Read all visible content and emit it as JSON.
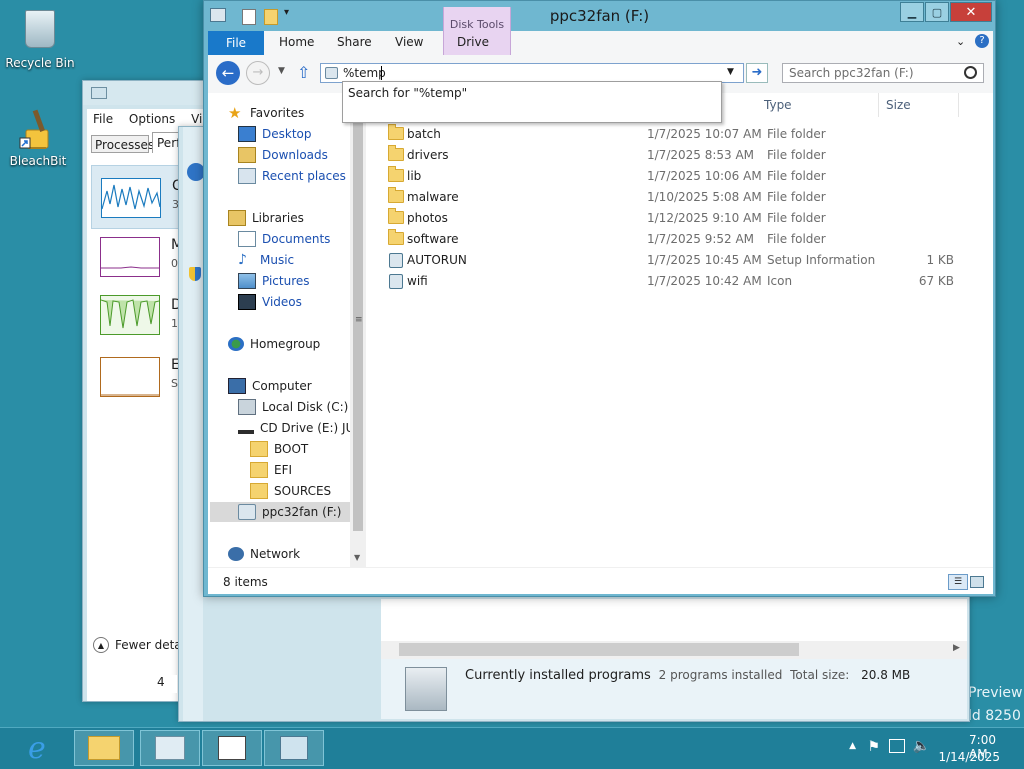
{
  "desktop": {
    "icons": [
      {
        "label": "Recycle Bin"
      },
      {
        "label": "BleachBit"
      }
    ],
    "watermark_line1": "Preview",
    "watermark_line2": "ld 8250"
  },
  "task_manager": {
    "menu": [
      "File",
      "Options",
      "View"
    ],
    "tabs": [
      "Processes",
      "Perf"
    ],
    "graph_letters": [
      "C",
      "M",
      "D",
      "E"
    ],
    "graph_sub": [
      "3",
      "0",
      "1",
      "S"
    ],
    "fewer_details": "Fewer deta",
    "bottom_value": "4"
  },
  "programs_window": {
    "summary_title": "Currently installed programs",
    "summary_count": "2 programs installed",
    "summary_size_label": "Total size:",
    "summary_size_value": "20.8 MB"
  },
  "explorer": {
    "title": "ppc32fan (F:)",
    "context_tab_group": "Disk Tools",
    "ribbon_tabs": [
      "File",
      "Home",
      "Share",
      "View",
      "Drive"
    ],
    "address_value": "%temp",
    "search_placeholder": "Search ppc32fan (F:)",
    "autocomplete_item": "Search for \"%temp\"",
    "columns": {
      "type": "Type",
      "size": "Size"
    },
    "nav": {
      "favorites": "Favorites",
      "desktop": "Desktop",
      "downloads": "Downloads",
      "recent": "Recent places",
      "libraries": "Libraries",
      "documents": "Documents",
      "music": "Music",
      "pictures": "Pictures",
      "videos": "Videos",
      "homegroup": "Homegroup",
      "computer": "Computer",
      "local_disk": "Local Disk (C:)",
      "cd_drive": "CD Drive (E:) JULI",
      "boot": "BOOT",
      "efi": "EFI",
      "sources": "SOURCES",
      "ppc": "ppc32fan (F:)",
      "network": "Network"
    },
    "files": [
      {
        "name": "batch",
        "date": "1/7/2025 10:07 AM",
        "type": "File folder",
        "size": "",
        "icon": "folder-icon"
      },
      {
        "name": "drivers",
        "date": "1/7/2025 8:53 AM",
        "type": "File folder",
        "size": "",
        "icon": "folder-icon"
      },
      {
        "name": "lib",
        "date": "1/7/2025 10:06 AM",
        "type": "File folder",
        "size": "",
        "icon": "folder-icon"
      },
      {
        "name": "malware",
        "date": "1/10/2025 5:08 AM",
        "type": "File folder",
        "size": "",
        "icon": "folder-icon"
      },
      {
        "name": "photos",
        "date": "1/12/2025 9:10 AM",
        "type": "File folder",
        "size": "",
        "icon": "folder-icon"
      },
      {
        "name": "software",
        "date": "1/7/2025 9:52 AM",
        "type": "File folder",
        "size": "",
        "icon": "folder-icon"
      },
      {
        "name": "AUTORUN",
        "date": "1/7/2025 10:45 AM",
        "type": "Setup Information",
        "size": "1 KB",
        "icon": "setup-file-icon"
      },
      {
        "name": "wifi",
        "date": "1/7/2025 10:42 AM",
        "type": "Icon",
        "size": "67 KB",
        "icon": "icon-file-icon"
      }
    ],
    "status_items": "8 items"
  },
  "taskbar": {
    "time": "7:00 AM",
    "date": "1/14/2025"
  },
  "colors": {
    "desktop": "#2a8ea6",
    "file_tab": "#1979ca",
    "window_frame": "#6fb7d0",
    "link_blue": "#1a4fb0"
  }
}
